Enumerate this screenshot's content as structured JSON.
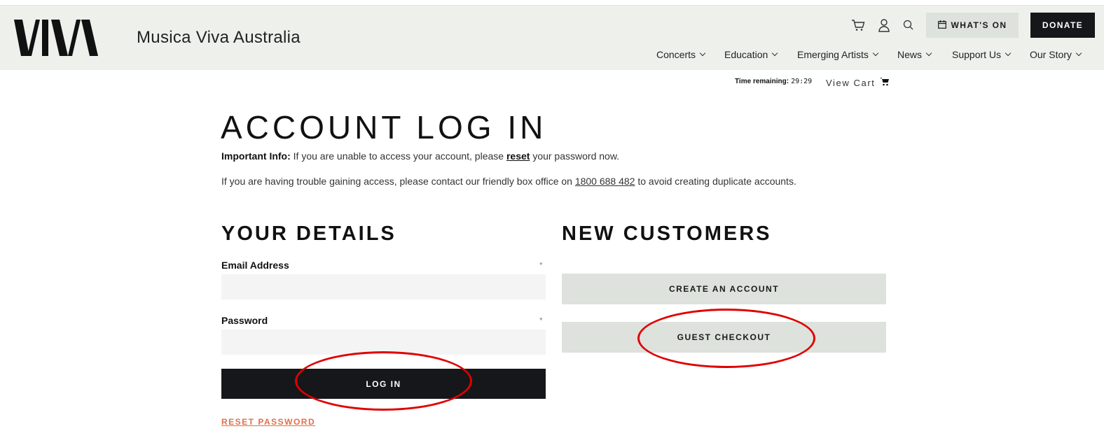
{
  "header": {
    "site_name": "Musica Viva Australia",
    "whats_on_label": "WHAT'S ON",
    "donate_label": "DONATE",
    "nav": [
      {
        "label": "Concerts"
      },
      {
        "label": "Education"
      },
      {
        "label": "Emerging Artists"
      },
      {
        "label": "News"
      },
      {
        "label": "Support Us"
      },
      {
        "label": "Our Story"
      }
    ]
  },
  "cart_bar": {
    "time_label": "Time remaining:",
    "time_value": "29:29",
    "view_cart_label": "View Cart"
  },
  "page": {
    "title": "ACCOUNT LOG IN",
    "info_label": "Important Info:",
    "info_text_before": "If you are unable to access your account, please",
    "info_link": "reset",
    "info_text_after": "your password now.",
    "trouble_before": "If you are having trouble gaining access, please contact our friendly box office on",
    "phone": "1800 688 482",
    "trouble_after": "to avoid creating duplicate accounts."
  },
  "details": {
    "title": "YOUR DETAILS",
    "email_label": "Email Address",
    "password_label": "Password",
    "required_mark": "*",
    "email_value": "",
    "password_value": "",
    "login_label": "LOG IN",
    "reset_label": "RESET PASSWORD"
  },
  "new_customers": {
    "title": "NEW CUSTOMERS",
    "create_label": "CREATE AN ACCOUNT",
    "guest_label": "GUEST CHECKOUT"
  },
  "colors": {
    "header_bg": "#eef0ec",
    "dark_button": "#16171a",
    "light_button": "#dde2dc",
    "link_accent": "#e0704a",
    "annotation": "#e00000"
  }
}
